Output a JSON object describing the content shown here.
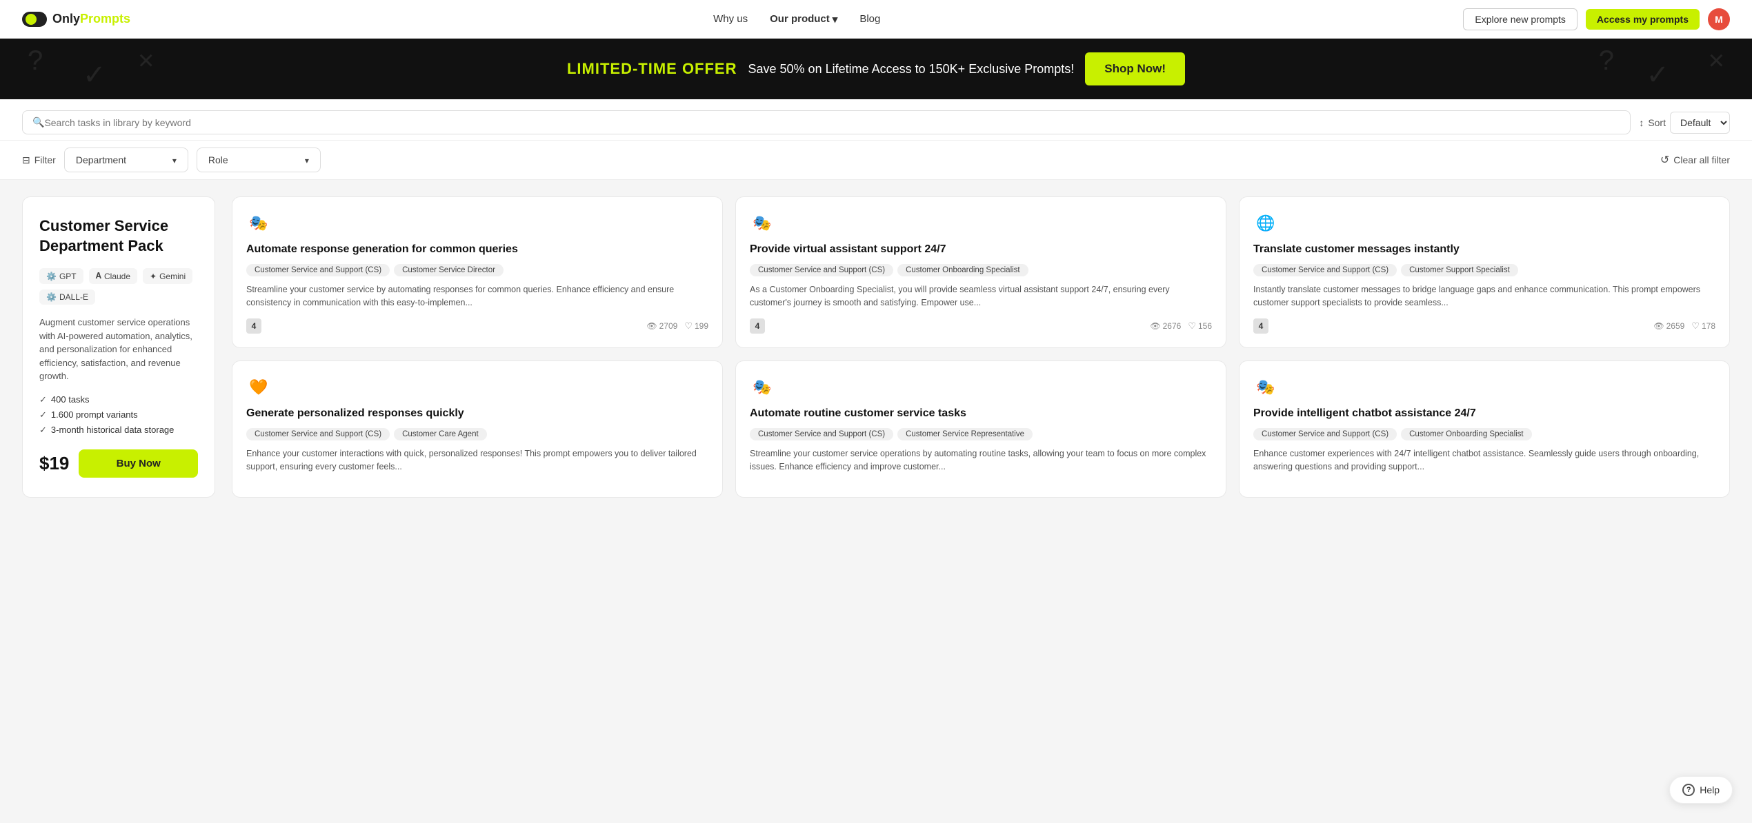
{
  "navbar": {
    "logo_text": "OnlyPrompts",
    "logo_only": "Only",
    "logo_prompts": "Prompts",
    "nav_links": [
      {
        "label": "Why us",
        "active": false
      },
      {
        "label": "Our product",
        "active": true,
        "has_dropdown": true
      },
      {
        "label": "Blog",
        "active": false
      }
    ],
    "btn_explore": "Explore new prompts",
    "btn_access": "Access my prompts",
    "avatar_letter": "M"
  },
  "banner": {
    "offer_label": "LIMITED-TIME OFFER",
    "text": "Save 50% on Lifetime Access to 150K+ Exclusive Prompts!",
    "btn_label": "Shop Now!"
  },
  "search": {
    "placeholder": "Search tasks in library by keyword",
    "sort_label": "Sort",
    "sort_default": "Default"
  },
  "filters": {
    "filter_label": "Filter",
    "department_label": "Department",
    "role_label": "Role",
    "clear_all_label": "Clear all filter"
  },
  "side_pack": {
    "title": "Customer Service Department Pack",
    "badges": [
      {
        "label": "GPT",
        "icon": "gpt"
      },
      {
        "label": "Claude",
        "icon": "claude"
      },
      {
        "label": "Gemini",
        "icon": "gemini"
      },
      {
        "label": "DALL-E",
        "icon": "dalle"
      }
    ],
    "description": "Augment customer service operations with AI-powered automation, analytics, and personalization for enhanced efficiency, satisfaction, and revenue growth.",
    "features": [
      "400 tasks",
      "1.600 prompt variants",
      "3-month historical data storage"
    ],
    "price": "$19",
    "buy_btn_label": "Buy Now"
  },
  "cards": [
    {
      "icon": "🎭",
      "title": "Automate response generation for common queries",
      "tags": [
        "Customer Service and Support (CS)",
        "Customer Service Director"
      ],
      "description": "Streamline your customer service by automating responses for common queries. Enhance efficiency and ensure consistency in communication with this easy-to-implemen...",
      "number": "4",
      "views": "2709",
      "likes": "199"
    },
    {
      "icon": "🎭",
      "title": "Provide virtual assistant support 24/7",
      "tags": [
        "Customer Service and Support (CS)",
        "Customer Onboarding Specialist"
      ],
      "description": "As a Customer Onboarding Specialist, you will provide seamless virtual assistant support 24/7, ensuring every customer's journey is smooth and satisfying. Empower use...",
      "number": "4",
      "views": "2676",
      "likes": "156"
    },
    {
      "icon": "🌐",
      "title": "Translate customer messages instantly",
      "tags": [
        "Customer Service and Support (CS)",
        "Customer Support Specialist"
      ],
      "description": "Instantly translate customer messages to bridge language gaps and enhance communication. This prompt empowers customer support specialists to provide seamless...",
      "number": "4",
      "views": "2659",
      "likes": "178"
    },
    {
      "icon": "🧡",
      "title": "Generate personalized responses quickly",
      "tags": [
        "Customer Service and Support (CS)",
        "Customer Care Agent"
      ],
      "description": "Enhance your customer interactions with quick, personalized responses! This prompt empowers you to deliver tailored support, ensuring every customer feels...",
      "number": null,
      "views": null,
      "likes": null
    },
    {
      "icon": "🎭",
      "title": "Automate routine customer service tasks",
      "tags": [
        "Customer Service and Support (CS)",
        "Customer Service Representative"
      ],
      "description": "Streamline your customer service operations by automating routine tasks, allowing your team to focus on more complex issues. Enhance efficiency and improve customer...",
      "number": null,
      "views": null,
      "likes": null
    },
    {
      "icon": "🎭",
      "title": "Provide intelligent chatbot assistance 24/7",
      "tags": [
        "Customer Service and Support (CS)",
        "Customer Onboarding Specialist"
      ],
      "description": "Enhance customer experiences with 24/7 intelligent chatbot assistance. Seamlessly guide users through onboarding, answering questions and providing support...",
      "number": null,
      "views": null,
      "likes": null
    }
  ],
  "help_btn": "Help"
}
